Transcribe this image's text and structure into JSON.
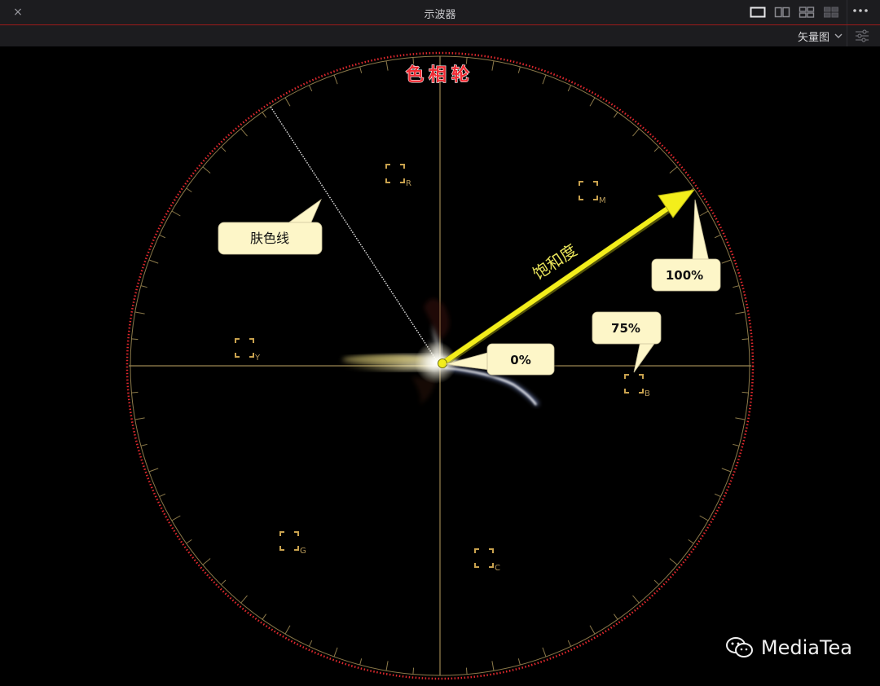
{
  "window": {
    "title": "示波器",
    "close_icon": "×"
  },
  "toolbar": {
    "scope_mode": "矢量图"
  },
  "vectorscope": {
    "title": "色相轮",
    "targets": [
      {
        "label": "R"
      },
      {
        "label": "M"
      },
      {
        "label": "Y"
      },
      {
        "label": "B"
      },
      {
        "label": "G"
      },
      {
        "label": "C"
      }
    ],
    "annotations": {
      "skin_tone_line": "肤色线",
      "saturation": "饱和度",
      "zero": "0%",
      "seventy_five": "75%",
      "hundred": "100%"
    },
    "colors": {
      "accent": "#e0282d",
      "graticule": "#9b8652",
      "target": "#c9a24e",
      "callout_bg": "#fdf6c8",
      "arrow": "#f3ee1b"
    }
  },
  "watermark": {
    "text": "MediaTea"
  }
}
